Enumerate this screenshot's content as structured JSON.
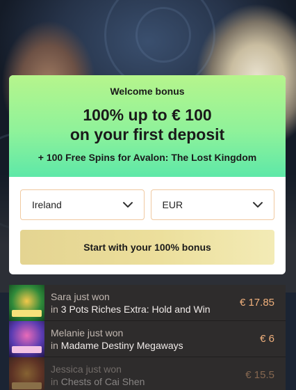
{
  "bonus": {
    "label": "Welcome bonus",
    "headline_line1": "100% up to € 100",
    "headline_line2": "on your first deposit",
    "free_spins": "+ 100 Free Spins for Avalon: The Lost Kingdom",
    "country_select": "Ireland",
    "currency_select": "EUR",
    "cta_label": "Start with your 100% bonus"
  },
  "winners": [
    {
      "name_line": "Sara just won",
      "prefix": "in",
      "game": "3 Pots Riches Extra: Hold and Win",
      "amount": "€ 17.85",
      "thumb_icon": "3-pots-riches-thumbnail"
    },
    {
      "name_line": "Melanie just won",
      "prefix": "in",
      "game": "Madame Destiny Megaways",
      "amount": "€ 6",
      "thumb_icon": "madame-destiny-thumbnail"
    },
    {
      "name_line": "Jessica just won",
      "prefix": "in",
      "game": "Chests of Cai Shen",
      "amount": "€ 15.5",
      "thumb_icon": "chests-of-cai-shen-thumbnail"
    }
  ],
  "colors": {
    "bonus_gradient_top": "#b6f58c",
    "bonus_gradient_bottom": "#5ee8a8",
    "cta_gold": "#e4d491",
    "amount_orange": "#f0b07c",
    "select_border": "#f0c9a0"
  }
}
